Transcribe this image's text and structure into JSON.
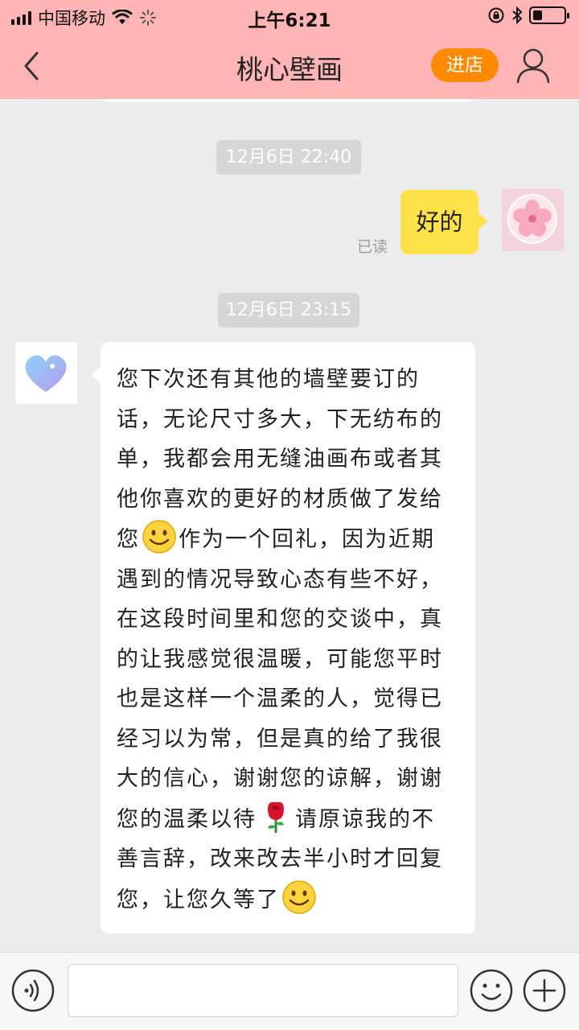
{
  "status_bar": {
    "carrier": "中国移动",
    "time": "上午6:21",
    "battery_level": 0.3
  },
  "nav": {
    "title": "桃心壁画",
    "shop_button": "进店"
  },
  "chat": {
    "messages": [
      {
        "timestamp": "12月6日 22:40"
      },
      {
        "side": "right",
        "text": "好的",
        "read_status": "已读"
      },
      {
        "timestamp": "12月6日 23:15"
      },
      {
        "side": "left",
        "lines": [
          "您下次还有其他的墙壁要订的",
          "话，无论尺寸多大，下无纺布的",
          "单，我都会用无缝油画布或者其",
          "他你喜欢的更好的材质做了发给",
          [
            "您",
            "作为一个回礼，因为近期"
          ],
          "遇到的情况导致心态有些不好，",
          "在这段时间里和您的交谈中，真",
          "的让我感觉很温暖，可能您平时",
          "也是这样一个温柔的人，觉得已",
          "经习以为常，但是真的给了我很",
          "大的信心，谢谢您的谅解，谢谢",
          [
            "您的温柔以待",
            "请原谅我的不"
          ],
          "善言辞，改来改去半小时才回复",
          [
            "您，让您久等了",
            ""
          ]
        ],
        "emojis": [
          "smile-emoji",
          "rose-emoji",
          "smile-emoji"
        ]
      }
    ]
  },
  "input_bar": {
    "placeholder": "",
    "icons": [
      "voice-icon",
      "emoji-icon",
      "plus-icon"
    ]
  },
  "colors": {
    "header_bg": "#ffb5b5",
    "shop_button": "#ff8a00",
    "own_bubble": "#ffe14a",
    "chat_bg": "#ececec"
  }
}
